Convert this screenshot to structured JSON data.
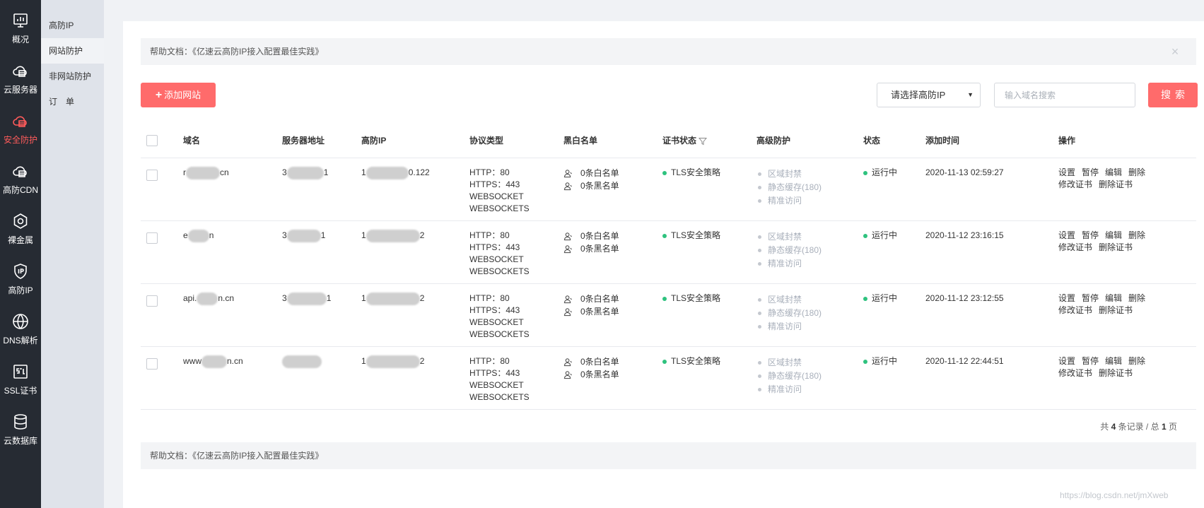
{
  "rail": [
    {
      "label": "概况",
      "icon": "monitor-icon",
      "active": false
    },
    {
      "label": "云服务器",
      "icon": "cloud-server-icon",
      "active": false
    },
    {
      "label": "安全防护",
      "icon": "cloud-shield-icon",
      "active": true
    },
    {
      "label": "高防CDN",
      "icon": "cdn-icon",
      "active": false
    },
    {
      "label": "裸金属",
      "icon": "hexagon-icon",
      "active": false
    },
    {
      "label": "高防IP",
      "icon": "ip-shield-icon",
      "active": false
    },
    {
      "label": "DNS解析",
      "icon": "dns-globe-icon",
      "active": false
    },
    {
      "label": "SSL证书",
      "icon": "ssl-icon",
      "active": false
    },
    {
      "label": "云数据库",
      "icon": "database-icon",
      "active": false
    }
  ],
  "submenu": [
    {
      "label": "高防IP",
      "active": false
    },
    {
      "label": "网站防护",
      "active": true
    },
    {
      "label": "非网站防护",
      "active": false
    },
    {
      "label": "订　单",
      "active": false
    }
  ],
  "help": {
    "text": "帮助文档：《亿速云高防IP接入配置最佳实践》",
    "close": "×"
  },
  "toolbar": {
    "add_label": "添加网站",
    "add_icon": "+",
    "select_label": "请选择高防IP",
    "search_placeholder": "输入域名搜索",
    "search_label": "搜索"
  },
  "table": {
    "headers": [
      "域名",
      "服务器地址",
      "高防IP",
      "协议类型",
      "黑白名单",
      "证书状态",
      "高级防护",
      "状态",
      "添加时间",
      "操作"
    ],
    "rows": [
      {
        "domain_prefix": "r",
        "domain_suffix": "cn",
        "server_prefix": "3",
        "server_suffix": "1",
        "ip_prefix": "1",
        "ip_suffix": "0.122",
        "protocols": [
          "HTTP：80",
          "HTTPS：443",
          "WEBSOCKET",
          "WEBSOCKETS"
        ],
        "whitelist": "0条白名单",
        "blacklist": "0条黑名单",
        "cert": "TLS安全策略",
        "advanced": [
          "区域封禁",
          "静态缓存(180)",
          "精准访问"
        ],
        "status": "运行中",
        "time": "2020-11-13 02:59:27",
        "ops1": [
          "设置",
          "暂停",
          "编辑",
          "删除"
        ],
        "ops2": [
          "修改证书",
          "删除证书"
        ]
      },
      {
        "domain_prefix": "e",
        "domain_suffix": "n",
        "server_prefix": "3",
        "server_suffix": "1",
        "ip_prefix": "1",
        "ip_suffix": "2",
        "protocols": [
          "HTTP：80",
          "HTTPS：443",
          "WEBSOCKET",
          "WEBSOCKETS"
        ],
        "whitelist": "0条白名单",
        "blacklist": "0条黑名单",
        "cert": "TLS安全策略",
        "advanced": [
          "区域封禁",
          "静态缓存(180)",
          "精准访问"
        ],
        "status": "运行中",
        "time": "2020-11-12 23:16:15",
        "ops1": [
          "设置",
          "暂停",
          "编辑",
          "删除"
        ],
        "ops2": [
          "修改证书",
          "删除证书"
        ]
      },
      {
        "domain_prefix": "api.",
        "domain_suffix": "n.cn",
        "server_prefix": "3",
        "server_suffix": "1",
        "ip_prefix": "1",
        "ip_suffix": "2",
        "protocols": [
          "HTTP：80",
          "HTTPS：443",
          "WEBSOCKET",
          "WEBSOCKETS"
        ],
        "whitelist": "0条白名单",
        "blacklist": "0条黑名单",
        "cert": "TLS安全策略",
        "advanced": [
          "区域封禁",
          "静态缓存(180)",
          "精准访问"
        ],
        "status": "运行中",
        "time": "2020-11-12 23:12:55",
        "ops1": [
          "设置",
          "暂停",
          "编辑",
          "删除"
        ],
        "ops2": [
          "修改证书",
          "删除证书"
        ]
      },
      {
        "domain_prefix": "www",
        "domain_suffix": "n.cn",
        "server_prefix": "",
        "server_suffix": "",
        "ip_prefix": "1",
        "ip_suffix": "2",
        "protocols": [
          "HTTP：80",
          "HTTPS：443",
          "WEBSOCKET",
          "WEBSOCKETS"
        ],
        "whitelist": "0条白名单",
        "blacklist": "0条黑名单",
        "cert": "TLS安全策略",
        "advanced": [
          "区域封禁",
          "静态缓存(180)",
          "精准访问"
        ],
        "status": "运行中",
        "time": "2020-11-12 22:44:51",
        "ops1": [
          "设置",
          "暂停",
          "编辑",
          "删除"
        ],
        "ops2": [
          "修改证书",
          "删除证书"
        ]
      }
    ]
  },
  "pager": {
    "prefix": "共",
    "total": "4",
    "middle": "条记录 / 总",
    "pages": "1",
    "suffix": "页"
  },
  "watermark": "https://blog.csdn.net/jmXweb",
  "colors": {
    "accent": "#ff6b6b",
    "active_nav": "#ff5b5b",
    "running": "#2ec27e",
    "rail_bg": "#262b33"
  }
}
